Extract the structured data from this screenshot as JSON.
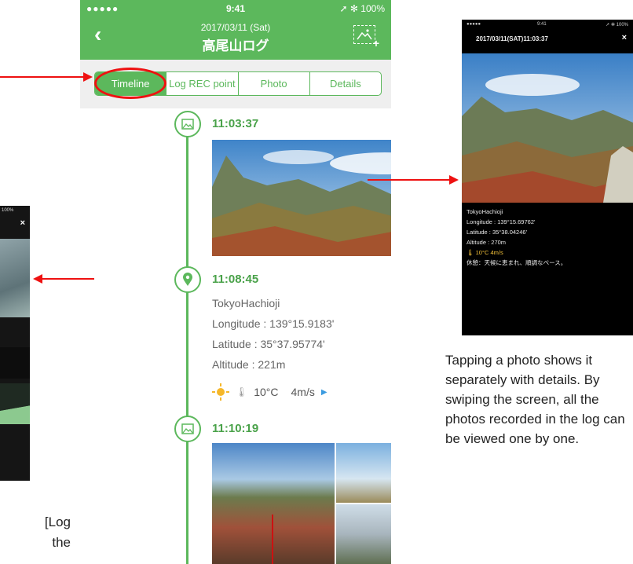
{
  "left_phone": {
    "close_symbol": "×",
    "status": "100%"
  },
  "left_caption": "[Log\n the\n",
  "phone": {
    "status": {
      "signal": "●●●●● ",
      "time": "9:41",
      "battery": "➚ ✻ 100%"
    },
    "header": {
      "back": "‹",
      "date": "2017/03/11 (Sat)",
      "title": "高尾山ログ",
      "add_photo_icon": "photo-add-icon"
    },
    "tabs": [
      {
        "label": "Timeline",
        "active": true
      },
      {
        "label": "Log REC point",
        "active": false
      },
      {
        "label": "Photo",
        "active": false
      },
      {
        "label": "Details",
        "active": false
      }
    ],
    "timeline": [
      {
        "type": "photo",
        "time": "11:03:37"
      },
      {
        "type": "location",
        "time": "11:08:45",
        "place": "TokyoHachioji",
        "longitude": "Longitude : 139°15.9183'",
        "latitude": "Latitude : 35°37.95774'",
        "altitude": "Altitude : 221m",
        "temperature": "10°C",
        "wind": "4m/s",
        "temp_icon": "🌡"
      },
      {
        "type": "photo",
        "time": "11:10:19"
      }
    ]
  },
  "right_phone": {
    "status_left": "●●●●● ",
    "status_time": "9:41",
    "status_right": "➚ ✻ 100%",
    "title": "2017/03/11(SAT)11:03:37",
    "close_symbol": "×",
    "info": [
      "TokyoHachioji",
      "Longitude : 139°15.69762'",
      "Latitude : 35°38.04246'",
      "Altitude : 270m",
      "🌡 10°C   4m/s",
      "休憩：天候に恵まれ、順調なペース。"
    ]
  },
  "right_caption": "Tapping a photo shows it separately with details. By swiping the screen, all the photos recorded in the log can be viewed one by one."
}
